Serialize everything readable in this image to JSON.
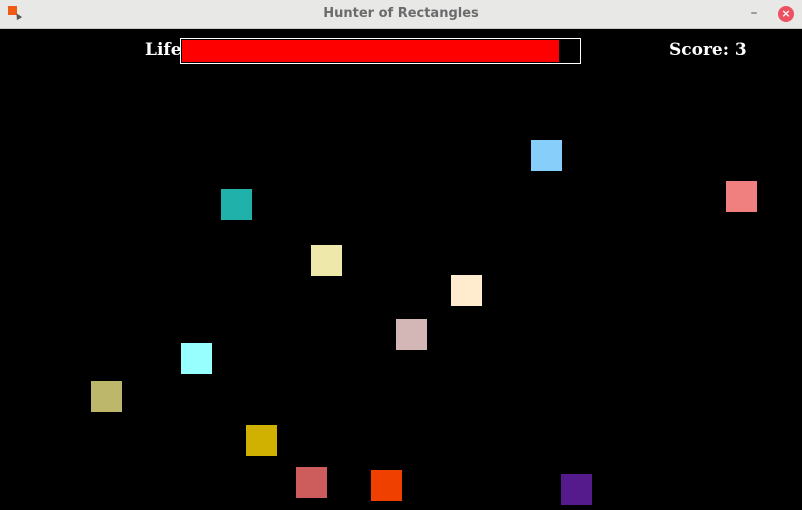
{
  "window": {
    "title": "Hunter of Rectangles",
    "icons": {
      "app": "app-icon",
      "minimize": "minimize-icon",
      "close": "close-icon"
    },
    "minimize_glyph": "–",
    "close_glyph": "×"
  },
  "hud": {
    "life_label": "Life",
    "life_fraction": 0.95,
    "life_color": "#ff0000",
    "score_text": "Score: 3"
  },
  "rectangles": [
    {
      "color": "#87cefa"
    },
    {
      "color": "#f08080"
    },
    {
      "color": "#20b2aa"
    },
    {
      "color": "#eee8aa"
    },
    {
      "color": "#ffebcd"
    },
    {
      "color": "#d2b7b6"
    },
    {
      "color": "#98ffff"
    },
    {
      "color": "#bdb76b"
    },
    {
      "color": "#d0b000"
    },
    {
      "color": "#cd5c5c"
    },
    {
      "color": "#f04000"
    },
    {
      "color": "#551a8b"
    }
  ]
}
